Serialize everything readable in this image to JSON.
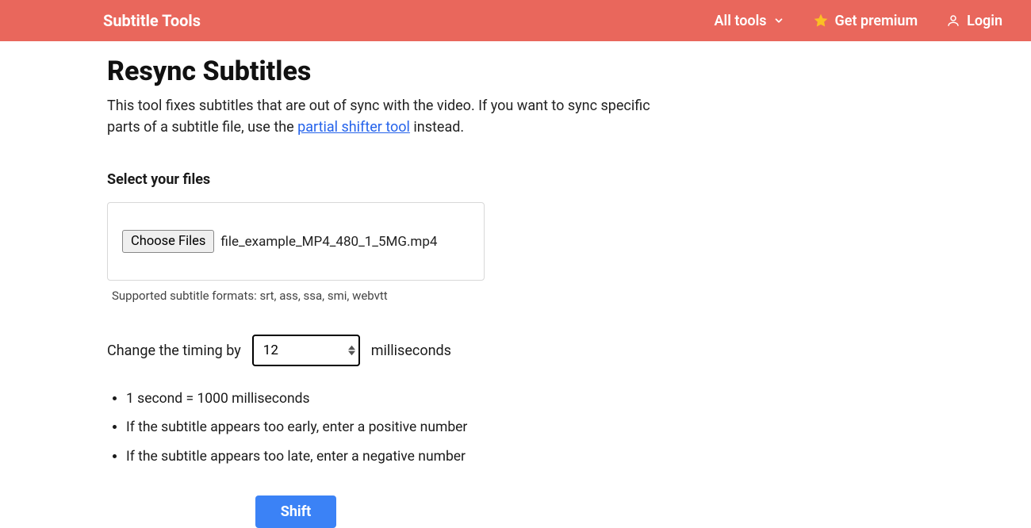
{
  "header": {
    "brand": "Subtitle Tools",
    "all_tools": "All tools",
    "premium": "Get premium",
    "login": "Login"
  },
  "page": {
    "title": "Resync Subtitles",
    "desc_before": "This tool fixes subtitles that are out of sync with the video. If you want to sync specific parts of a subtitle file, use the ",
    "desc_link": "partial shifter tool",
    "desc_after": " instead.",
    "select_label": "Select your files",
    "choose_btn": "Choose Files",
    "filename": "file_example_MP4_480_1_5MG.mp4",
    "supported": "Supported subtitle formats: srt, ass, ssa, smi, webvtt",
    "timing_before": "Change the timing by",
    "timing_value": "12",
    "timing_after": "milliseconds",
    "hints": [
      "1 second = 1000 milliseconds",
      "If the subtitle appears too early, enter a positive number",
      "If the subtitle appears too late, enter a negative number"
    ],
    "shift_btn": "Shift"
  }
}
